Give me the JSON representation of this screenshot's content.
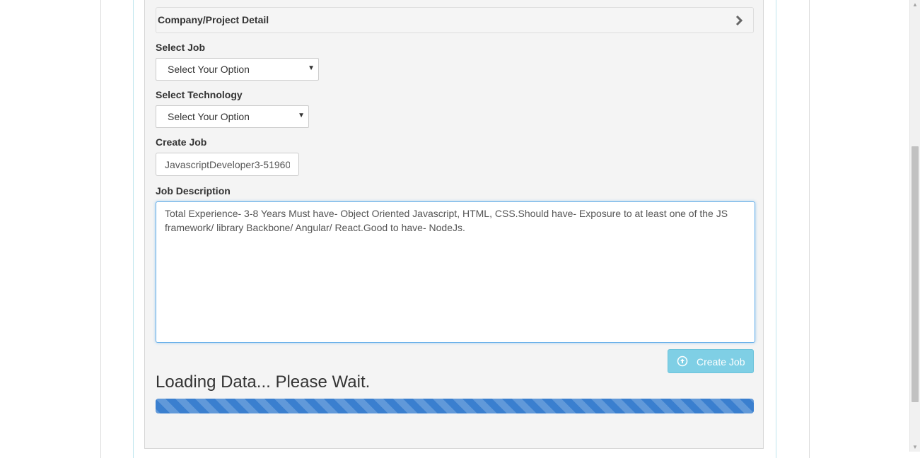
{
  "accordion": {
    "title": "Company/Project Detail"
  },
  "form": {
    "select_job": {
      "label": "Select Job",
      "value": "Select Your Option"
    },
    "select_technology": {
      "label": "Select Technology",
      "value": "Select Your Option"
    },
    "create_job": {
      "label": "Create Job",
      "value": "JavascriptDeveloper3-51960"
    },
    "job_description": {
      "label": "Job Description",
      "value": "Total Experience- 3-8 Years Must have- Object Oriented Javascript, HTML, CSS.Should have- Exposure to at least one of the JS framework/ library Backbone/ Angular/ React.Good to have- NodeJs."
    },
    "submit_label": "Create Job"
  },
  "status": {
    "loading_text": "Loading Data... Please Wait.",
    "progress_percent": 100
  },
  "icons": {
    "accordion": "chevron-right-icon",
    "submit": "arrow-up-circle-icon"
  },
  "colors": {
    "button": "#7fcfe5",
    "progress": "#3a7fcf",
    "focus_border": "#66afe9"
  }
}
